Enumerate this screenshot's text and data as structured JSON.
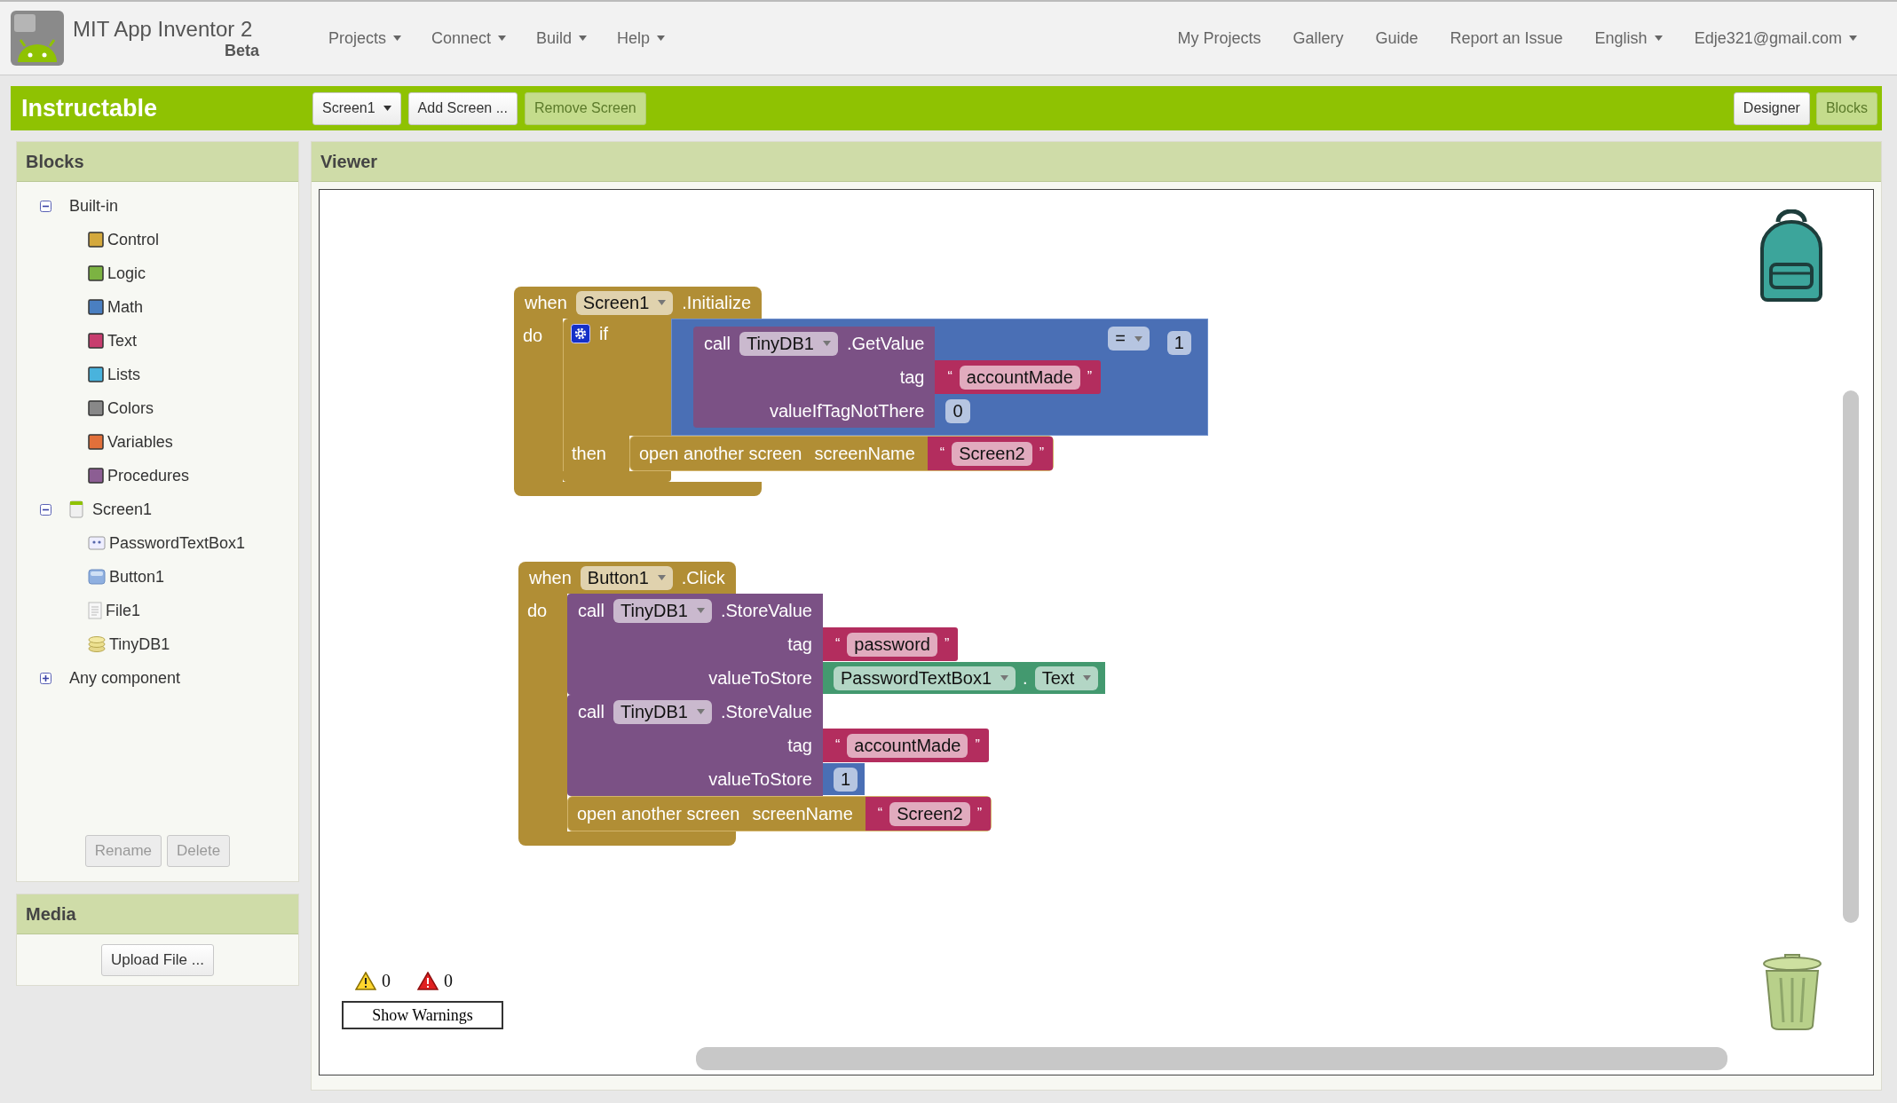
{
  "header": {
    "title": "MIT App Inventor 2",
    "subtitle": "Beta",
    "menu": [
      {
        "label": "Projects",
        "dropdown": true
      },
      {
        "label": "Connect",
        "dropdown": true
      },
      {
        "label": "Build",
        "dropdown": true
      },
      {
        "label": "Help",
        "dropdown": true
      }
    ],
    "right_menu": [
      {
        "label": "My Projects",
        "dropdown": false
      },
      {
        "label": "Gallery",
        "dropdown": false
      },
      {
        "label": "Guide",
        "dropdown": false
      },
      {
        "label": "Report an Issue",
        "dropdown": false
      },
      {
        "label": "English",
        "dropdown": true
      },
      {
        "label": "Edje321@gmail.com",
        "dropdown": true
      }
    ]
  },
  "project": {
    "name": "Instructable",
    "buttons": [
      {
        "label": "Screen1",
        "dropdown": true,
        "disabled": false
      },
      {
        "label": "Add Screen ...",
        "dropdown": false,
        "disabled": false
      },
      {
        "label": "Remove Screen",
        "dropdown": false,
        "disabled": true
      }
    ],
    "views": [
      {
        "label": "Designer",
        "selected": false
      },
      {
        "label": "Blocks",
        "selected": true
      }
    ]
  },
  "blocks_panel": {
    "title": "Blocks",
    "tree": [
      {
        "label": "Built-in",
        "kind": "group",
        "expanded": true,
        "children": [
          {
            "label": "Control",
            "kind": "category",
            "color": "#d4a93d"
          },
          {
            "label": "Logic",
            "kind": "category",
            "color": "#7cb342"
          },
          {
            "label": "Math",
            "kind": "category",
            "color": "#4a7fc1"
          },
          {
            "label": "Text",
            "kind": "category",
            "color": "#c73d6e"
          },
          {
            "label": "Lists",
            "kind": "category",
            "color": "#49b3dd"
          },
          {
            "label": "Colors",
            "kind": "category",
            "color": "#888888"
          },
          {
            "label": "Variables",
            "kind": "category",
            "color": "#e2703a"
          },
          {
            "label": "Procedures",
            "kind": "category",
            "color": "#8c5e93"
          }
        ]
      },
      {
        "label": "Screen1",
        "kind": "screen",
        "expanded": true,
        "children": [
          {
            "label": "PasswordTextBox1",
            "kind": "password"
          },
          {
            "label": "Button1",
            "kind": "button"
          },
          {
            "label": "File1",
            "kind": "file"
          },
          {
            "label": "TinyDB1",
            "kind": "database"
          }
        ]
      },
      {
        "label": "Any component",
        "kind": "group",
        "expanded": false
      }
    ],
    "buttons": [
      {
        "label": "Rename",
        "disabled": true
      },
      {
        "label": "Delete",
        "disabled": true
      }
    ]
  },
  "media_panel": {
    "title": "Media",
    "button": "Upload File ..."
  },
  "viewer": {
    "title": "Viewer",
    "blocks": [
      {
        "kind": "event",
        "when": "when",
        "component": "Screen1",
        "event": ".Initialize",
        "do": "do",
        "body": [
          {
            "kind": "if",
            "if": "if",
            "then": "then",
            "condition": {
              "kind": "compare",
              "op": "=",
              "left": {
                "kind": "call",
                "call": "call",
                "component": "TinyDB1",
                "method": ".GetValue",
                "args": [
                  {
                    "name": "tag",
                    "value": {
                      "kind": "text",
                      "quotes": [
                        "“",
                        "”"
                      ],
                      "text": "accountMade"
                    }
                  },
                  {
                    "name": "valueIfTagNotThere",
                    "value": {
                      "kind": "number",
                      "number": "0"
                    }
                  }
                ]
              },
              "right": {
                "kind": "number",
                "number": "1"
              }
            },
            "body": [
              {
                "kind": "open_screen",
                "label": "open another screen",
                "arg": "screenName",
                "value": {
                  "kind": "text",
                  "quotes": [
                    "“",
                    "”"
                  ],
                  "text": "Screen2"
                }
              }
            ]
          }
        ]
      },
      {
        "kind": "event",
        "when": "when",
        "component": "Button1",
        "event": ".Click",
        "do": "do",
        "body": [
          {
            "kind": "call",
            "call": "call",
            "component": "TinyDB1",
            "method": ".StoreValue",
            "args": [
              {
                "name": "tag",
                "value": {
                  "kind": "text",
                  "quotes": [
                    "“",
                    "”"
                  ],
                  "text": "password"
                }
              },
              {
                "name": "valueToStore",
                "value": {
                  "kind": "getter",
                  "component": "PasswordTextBox1",
                  "separator": ".",
                  "property": "Text"
                }
              }
            ]
          },
          {
            "kind": "call",
            "call": "call",
            "component": "TinyDB1",
            "method": ".StoreValue",
            "args": [
              {
                "name": "tag",
                "value": {
                  "kind": "text",
                  "quotes": [
                    "“",
                    "”"
                  ],
                  "text": "accountMade"
                }
              },
              {
                "name": "valueToStore",
                "value": {
                  "kind": "number",
                  "number": "1"
                }
              }
            ]
          },
          {
            "kind": "open_screen",
            "label": "open another screen",
            "arg": "screenName",
            "value": {
              "kind": "text",
              "quotes": [
                "“",
                "”"
              ],
              "text": "Screen2"
            }
          }
        ]
      }
    ],
    "warnings": {
      "warning_count": "0",
      "error_count": "0",
      "button": "Show Warnings"
    }
  }
}
